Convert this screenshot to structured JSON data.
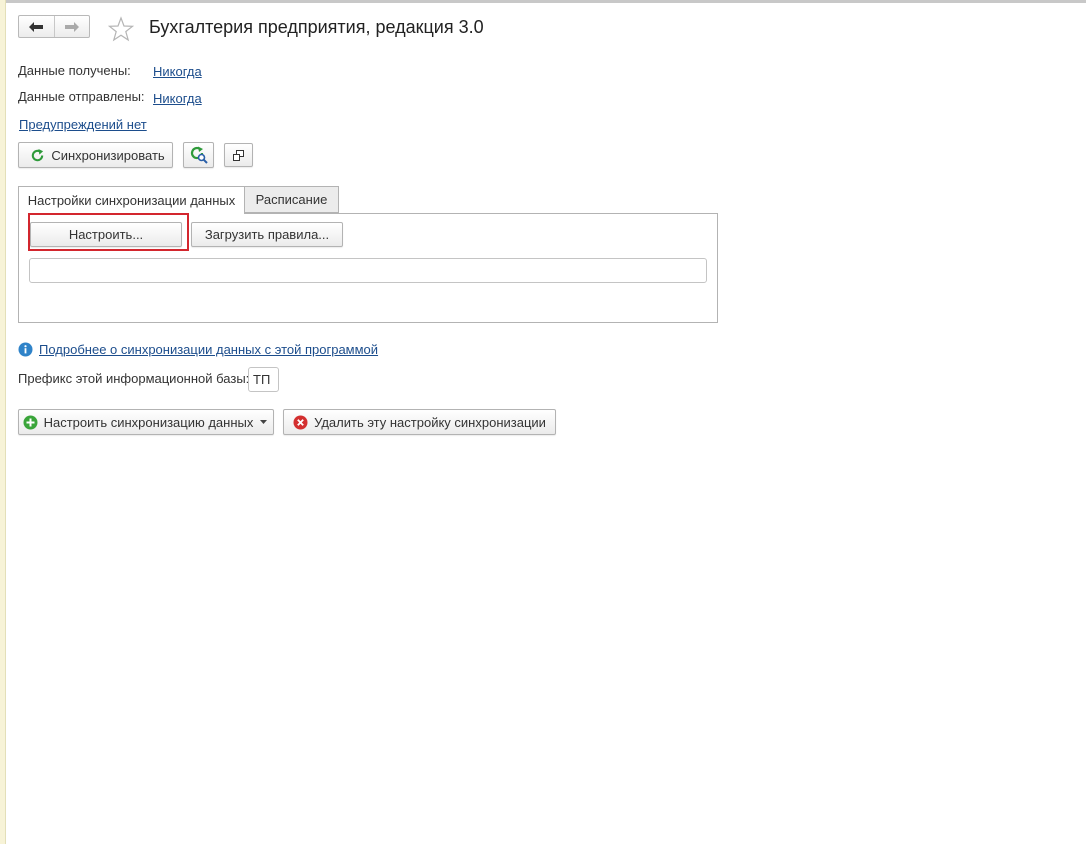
{
  "window": {
    "title": "Бухгалтерия предприятия, редакция 3.0"
  },
  "nav": {
    "back_icon": "arrow-left-icon",
    "forward_icon": "arrow-right-icon",
    "favorite_icon": "star-icon"
  },
  "status": {
    "received_label": "Данные получены:",
    "received_value": "Никогда",
    "sent_label": "Данные отправлены:",
    "sent_value": "Никогда",
    "warnings_link": "Предупреждений нет"
  },
  "toolbar": {
    "sync_label": "Синхронизировать",
    "sync_icon": "refresh-green-icon",
    "sync_check_icon": "refresh-magnifier-icon",
    "open_window_icon": "open-in-window-icon"
  },
  "tabs": [
    {
      "label": "Настройки синхронизации данных",
      "active": true
    },
    {
      "label": "Расписание",
      "active": false
    }
  ],
  "settings_panel": {
    "configure_label": "Настроить...",
    "load_rules_label": "Загрузить правила...",
    "info_field_value": ""
  },
  "info": {
    "icon": "info-icon",
    "more_link": "Подробнее о синхронизации данных с этой программой"
  },
  "prefix": {
    "label": "Префикс этой информационной базы:",
    "value": "ТП"
  },
  "actions": {
    "setup_sync_label": "Настроить синхронизацию данных",
    "setup_sync_icon": "plus-green-icon",
    "delete_sync_label": "Удалить эту настройку синхронизации",
    "delete_sync_icon": "delete-red-icon"
  },
  "colors": {
    "link": "#1c4d8c",
    "highlight_border": "#d3262e",
    "info_icon": "#2f83c9",
    "add_icon": "#3aa53a",
    "delete_icon": "#d32f2f"
  }
}
